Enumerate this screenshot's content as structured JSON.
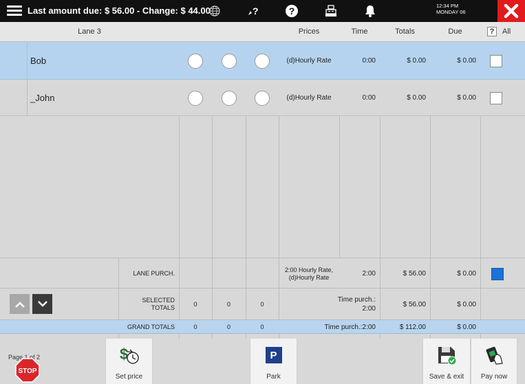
{
  "topbar": {
    "title": "Last amount due: $ 56.00 - Change: $ 44.00",
    "time": "12:34 PM",
    "day": "MONDAY 06",
    "icons": [
      "globe-icon",
      "help-pointer-icon",
      "question-icon",
      "cash-register-icon",
      "bell-icon",
      "close-icon"
    ]
  },
  "table": {
    "headers": {
      "lane": "Lane 3",
      "prices": "Prices",
      "time": "Time",
      "totals": "Totals",
      "due": "Due",
      "help": "?",
      "all": "All"
    },
    "rows": [
      {
        "name": "Bob",
        "price": "(d)Hourly Rate",
        "time": "0:00",
        "total": "$ 0.00",
        "due": "$ 0.00",
        "selected": true
      },
      {
        "name": "_John",
        "price": "(d)Hourly Rate",
        "time": "0:00",
        "total": "$ 0.00",
        "due": "$ 0.00",
        "selected": false
      }
    ],
    "lane_purch": {
      "label": "LANE PURCH.",
      "price": "2:00 Hourly Rate, (d)Hourly Rate",
      "time": "2:00",
      "total": "$ 56.00",
      "due": "$ 0.00"
    },
    "selected_totals": {
      "label": "SELECTED TOTALS",
      "c1": "0",
      "c2": "0",
      "c3": "0",
      "time_label": "Time purch.:",
      "time": "2:00",
      "total": "$ 56.00",
      "due": "$ 0.00"
    },
    "grand_totals": {
      "label": "GRAND TOTALS",
      "c1": "0",
      "c2": "0",
      "c3": "0",
      "time": "Time purch.:2:00",
      "total": "$ 112.00",
      "due": "$ 0.00"
    }
  },
  "pager": {
    "text": "Page 1 of 2"
  },
  "toolbar": {
    "set_price": "Set price",
    "park": "Park",
    "park_icon_letter": "P",
    "save_exit": "Save & exit",
    "pay_now": "Pay now",
    "stop": "STOP"
  },
  "colors": {
    "selected_row": "#b5d3ee",
    "grand_row": "#b8d4ee",
    "close": "#e21b1b",
    "accent": "#1a73d9"
  }
}
